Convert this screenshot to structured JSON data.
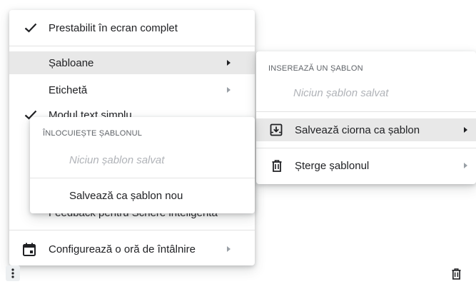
{
  "main_menu": {
    "fullscreen_default": "Prestabilit în ecran complet",
    "templates": "Șabloane",
    "label": "Etichetă",
    "plain_text": "Modul text simplu",
    "feedback": "Feedback pentru Scriere inteligentă",
    "schedule_meeting": "Configurează o oră de întâlnire"
  },
  "insert_submenu": {
    "heading": "INSEREAZĂ UN ȘABLON",
    "empty": "Niciun șablon salvat",
    "save_draft": "Salvează ciorna ca șablon",
    "delete": "Șterge șablonul"
  },
  "replace_submenu": {
    "heading": "ÎNLOCUIEȘTE ȘABLONUL",
    "empty": "Niciun șablon salvat",
    "save_new": "Salvează ca șablon nou"
  },
  "icons": {
    "check": "check-icon",
    "calendar": "calendar-icon",
    "save_template": "save-template-icon",
    "trash": "trash-icon",
    "more": "more-vert-icon"
  }
}
